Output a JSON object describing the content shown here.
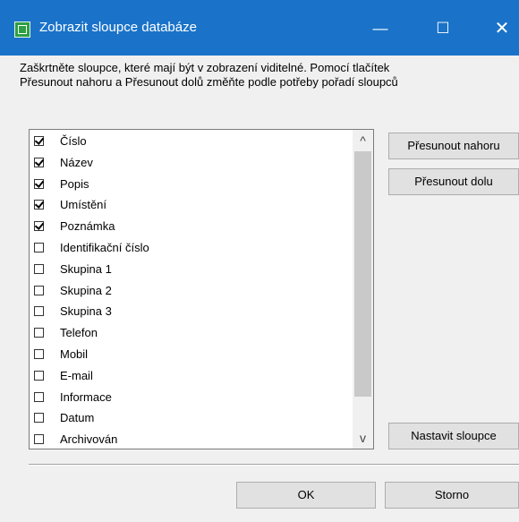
{
  "window": {
    "title": "Zobrazit sloupce databáze",
    "icon": "app-icon",
    "controls": {
      "minimize": "—",
      "maximize": "☐",
      "close": "✕"
    }
  },
  "instructions": {
    "line1": "Zaškrtněte sloupce, které mají být v zobrazení viditelné. Pomocí tlačítek",
    "line2": "Přesunout nahoru a Přesunout dolů změňte podle potřeby pořadí sloupců"
  },
  "columns": [
    {
      "label": "Číslo",
      "checked": true
    },
    {
      "label": "Název",
      "checked": true
    },
    {
      "label": "Popis",
      "checked": true
    },
    {
      "label": "Umístění",
      "checked": true
    },
    {
      "label": "Poznámka",
      "checked": true
    },
    {
      "label": "Identifikační číslo",
      "checked": false
    },
    {
      "label": "Skupina 1",
      "checked": false
    },
    {
      "label": "Skupina 2",
      "checked": false
    },
    {
      "label": "Skupina 3",
      "checked": false
    },
    {
      "label": "Telefon",
      "checked": false
    },
    {
      "label": "Mobil",
      "checked": false
    },
    {
      "label": "E-mail",
      "checked": false
    },
    {
      "label": "Informace",
      "checked": false
    },
    {
      "label": "Datum",
      "checked": false
    },
    {
      "label": "Archivován",
      "checked": false
    }
  ],
  "scrollbar": {
    "up": "^",
    "down": "v"
  },
  "buttons": {
    "move_up": "Přesunout nahoru",
    "move_down": "Přesunout dolu",
    "set_columns": "Nastavit sloupce",
    "ok": "OK",
    "cancel": "Storno"
  }
}
